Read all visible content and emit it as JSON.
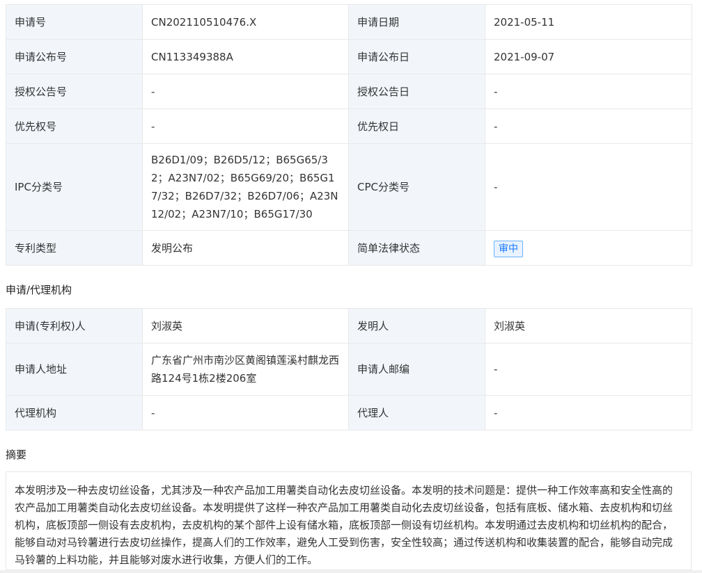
{
  "basic": {
    "rows": [
      {
        "l1": "申请号",
        "v1": "CN202110510476.X",
        "l2": "申请日期",
        "v2": "2021-05-11"
      },
      {
        "l1": "申请公布号",
        "v1": "CN113349388A",
        "l2": "申请公布日",
        "v2": "2021-09-07"
      },
      {
        "l1": "授权公告号",
        "v1": "-",
        "l2": "授权公告日",
        "v2": "-"
      },
      {
        "l1": "优先权号",
        "v1": "-",
        "l2": "优先权日",
        "v2": "-"
      },
      {
        "l1": "IPC分类号",
        "v1": "B26D1/09；B26D5/12；B65G65/32；A23N7/02；B65G69/20；B65G17/32；B26D7/32；B26D7/06；A23N12/02；A23N7/10；B65G17/30",
        "l2": "CPC分类号",
        "v2": "-"
      },
      {
        "l1": "专利类型",
        "v1": "发明公布",
        "l2": "简单法律状态",
        "v2": "审中"
      }
    ]
  },
  "agency": {
    "title": "申请/代理机构",
    "rows": [
      {
        "l1": "申请(专利权)人",
        "v1": "刘淑英",
        "l2": "发明人",
        "v2": "刘淑英"
      },
      {
        "l1": "申请人地址",
        "v1": "广东省广州市南沙区黄阁镇莲溪村麒龙西路124号1栋2楼206室",
        "l2": "申请人邮编",
        "v2": "-"
      },
      {
        "l1": "代理机构",
        "v1": "-",
        "l2": "代理人",
        "v2": "-"
      }
    ]
  },
  "abstract": {
    "title": "摘要",
    "text": "本发明涉及一种去皮切丝设备，尤其涉及一种农产品加工用薯类自动化去皮切丝设备。本发明的技术问题是：提供一种工作效率高和安全性高的农产品加工用薯类自动化去皮切丝设备。本发明提供了这样一种农产品加工用薯类自动化去皮切丝设备，包括有底板、储水箱、去皮机构和切丝机构，底板顶部一侧设有去皮机构，去皮机构的某个部件上设有储水箱，底板顶部一侧设有切丝机构。本发明通过去皮机构和切丝机构的配合，能够自动对马铃薯进行去皮切丝操作，提高人们的工作效率，避免人工受到伤害，安全性较高；通过传送机构和收集装置的配合，能够自动完成马铃薯的上料功能，并且能够对废水进行收集，方便人们的工作。"
  }
}
